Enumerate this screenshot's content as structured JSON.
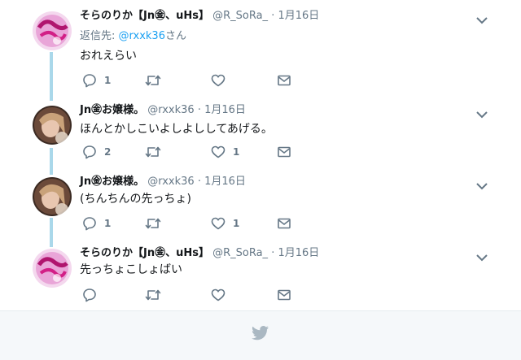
{
  "tweets": [
    {
      "name": "そらのりか【Jn㊎、uHs】",
      "handle": "@R_SoRa_",
      "dot": "·",
      "time": "1月16日",
      "reply_prefix": "返信先: ",
      "reply_handle": "@rxxk36",
      "reply_suffix": "さん",
      "text": "おれえらい",
      "reply_count": "1",
      "retweet_count": "",
      "like_count": ""
    },
    {
      "name": "Jn㊎お嬢様。",
      "handle": "@rxxk36",
      "dot": "·",
      "time": "1月16日",
      "text": "ほんとかしこいよしよししてあげる。",
      "reply_count": "2",
      "retweet_count": "",
      "like_count": "1"
    },
    {
      "name": "Jn㊎お嬢様。",
      "handle": "@rxxk36",
      "dot": "·",
      "time": "1月16日",
      "text": "(ちんちんの先っちょ)",
      "reply_count": "1",
      "retweet_count": "",
      "like_count": "1"
    },
    {
      "name": "そらのりか【Jn㊎、uHs】",
      "handle": "@R_SoRa_",
      "dot": "·",
      "time": "1月16日",
      "text": "先っちょこしょばい",
      "reply_count": "",
      "retweet_count": "",
      "like_count": ""
    }
  ],
  "icons": {
    "reply": "reply-icon",
    "retweet": "retweet-icon",
    "like": "like-icon",
    "dm": "direct-message-icon",
    "caret": "chevron-down-icon",
    "footer": "twitter-bird-icon"
  },
  "colors": {
    "thread_line": "#aad8ea",
    "link": "#1da1f2",
    "secondary_text": "#657786",
    "footer_bg": "#f5f8fa"
  }
}
